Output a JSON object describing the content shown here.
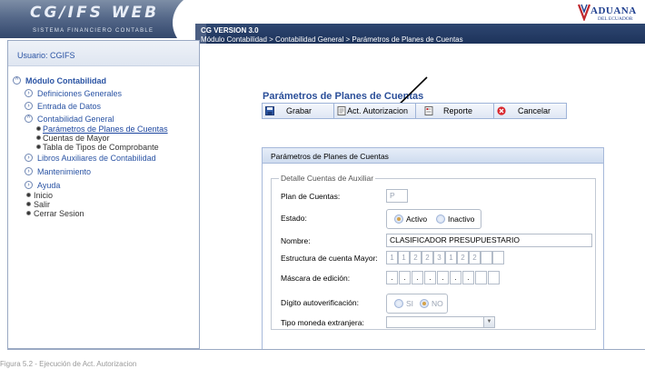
{
  "header": {
    "logo_title": "CG/IFS WEB",
    "logo_subtitle": "SISTEMA FINANCIERO CONTABLE",
    "version": "CG VERSION 3.0",
    "breadcrumb": "Módulo Contabilidad > Contabilidad General > Parámetros de Planes de Cuentas",
    "brand_name": "ADUANA",
    "brand_sub": "DEL ECUADOR"
  },
  "sidebar": {
    "user_label": "Usuario: CGIFS",
    "module": "Módulo Contabilidad",
    "items": [
      {
        "label": "Definiciones Generales"
      },
      {
        "label": "Entrada de Datos"
      },
      {
        "label": "Contabilidad General"
      },
      {
        "label": "Parámetros de Planes de Cuentas"
      },
      {
        "label": "Cuentas de Mayor"
      },
      {
        "label": "Tabla de Tipos de Comprobante"
      },
      {
        "label": "Libros Auxiliares de Contabilidad"
      },
      {
        "label": "Mantenimiento"
      },
      {
        "label": "Ayuda"
      },
      {
        "label": "Inicio"
      },
      {
        "label": "Salir"
      },
      {
        "label": "Cerrar Sesion"
      }
    ]
  },
  "main": {
    "title": "Parámetros de Planes de Cuentas",
    "toolbar": {
      "grabar": "Grabar",
      "act_autorizacion": "Act. Autorizacion",
      "reporte": "Reporte",
      "cancelar": "Cancelar"
    },
    "panel_title": "Parámetros de Planes de Cuentas",
    "fieldset_legend": "Detalle Cuentas de Auxiliar",
    "fields": {
      "plan_label": "Plan de Cuentas:",
      "plan_value": "P",
      "estado_label": "Estado:",
      "estado_activo": "Activo",
      "estado_inactivo": "Inactivo",
      "nombre_label": "Nombre:",
      "nombre_value": "CLASIFICADOR PRESUPUESTARIO",
      "estructura_label": "Estructura de cuenta Mayor:",
      "estructura_segments": [
        "1",
        "1",
        "2",
        "2",
        "3",
        "1",
        "2",
        "2",
        "",
        ""
      ],
      "mascara_label": "Máscara de edición:",
      "mascara_segments": [
        ".",
        ".",
        ".",
        ".",
        ".",
        ".",
        ".",
        "",
        ""
      ],
      "digito_label": "Dígito autoverificación:",
      "digito_si": "SI",
      "digito_no": "NO",
      "moneda_label": "Tipo moneda extranjera:",
      "moneda_value": ""
    }
  },
  "caption": "Figura 5.2 - Ejecución de Act. Autorizacion"
}
